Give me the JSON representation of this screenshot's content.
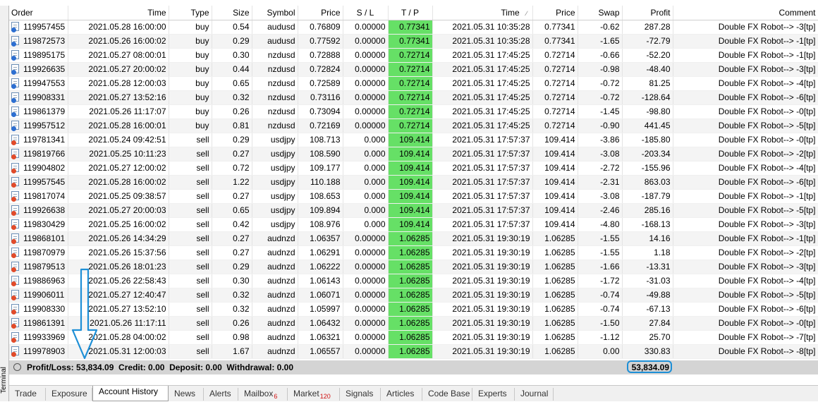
{
  "terminal": {
    "side_label": "Terminal",
    "columns": [
      "Order",
      "Time",
      "Type",
      "Size",
      "Symbol",
      "Price",
      "S / L",
      "T / P",
      "Time",
      "Price",
      "Swap",
      "Profit",
      "Comment"
    ],
    "sort_indicator": "∕",
    "rows": [
      {
        "order": "119957455",
        "open_time": "2021.05.28 16:00:00",
        "type": "buy",
        "size": "0.54",
        "symbol": "audusd",
        "open_price": "0.76809",
        "sl": "0.00000",
        "tp": "0.77341",
        "close_time": "2021.05.31 10:35:28",
        "close_price": "0.77341",
        "swap": "-0.62",
        "profit": "287.28",
        "comment": "Double FX Robot--> -3[tp]"
      },
      {
        "order": "119872573",
        "open_time": "2021.05.26 16:00:02",
        "type": "buy",
        "size": "0.29",
        "symbol": "audusd",
        "open_price": "0.77592",
        "sl": "0.00000",
        "tp": "0.77341",
        "close_time": "2021.05.31 10:35:28",
        "close_price": "0.77341",
        "swap": "-1.65",
        "profit": "-72.79",
        "comment": "Double FX Robot--> -1[tp]"
      },
      {
        "order": "119895175",
        "open_time": "2021.05.27 08:00:01",
        "type": "buy",
        "size": "0.30",
        "symbol": "nzdusd",
        "open_price": "0.72888",
        "sl": "0.00000",
        "tp": "0.72714",
        "close_time": "2021.05.31 17:45:25",
        "close_price": "0.72714",
        "swap": "-0.66",
        "profit": "-52.20",
        "comment": "Double FX Robot--> -1[tp]"
      },
      {
        "order": "119926635",
        "open_time": "2021.05.27 20:00:02",
        "type": "buy",
        "size": "0.44",
        "symbol": "nzdusd",
        "open_price": "0.72824",
        "sl": "0.00000",
        "tp": "0.72714",
        "close_time": "2021.05.31 17:45:25",
        "close_price": "0.72714",
        "swap": "-0.98",
        "profit": "-48.40",
        "comment": "Double FX Robot--> -3[tp]"
      },
      {
        "order": "119947553",
        "open_time": "2021.05.28 12:00:03",
        "type": "buy",
        "size": "0.65",
        "symbol": "nzdusd",
        "open_price": "0.72589",
        "sl": "0.00000",
        "tp": "0.72714",
        "close_time": "2021.05.31 17:45:25",
        "close_price": "0.72714",
        "swap": "-0.72",
        "profit": "81.25",
        "comment": "Double FX Robot--> -4[tp]"
      },
      {
        "order": "119908331",
        "open_time": "2021.05.27 13:52:16",
        "type": "buy",
        "size": "0.32",
        "symbol": "nzdusd",
        "open_price": "0.73116",
        "sl": "0.00000",
        "tp": "0.72714",
        "close_time": "2021.05.31 17:45:25",
        "close_price": "0.72714",
        "swap": "-0.72",
        "profit": "-128.64",
        "comment": "Double FX Robot--> -6[tp]"
      },
      {
        "order": "119861379",
        "open_time": "2021.05.26 11:17:07",
        "type": "buy",
        "size": "0.26",
        "symbol": "nzdusd",
        "open_price": "0.73094",
        "sl": "0.00000",
        "tp": "0.72714",
        "close_time": "2021.05.31 17:45:25",
        "close_price": "0.72714",
        "swap": "-1.45",
        "profit": "-98.80",
        "comment": "Double FX Robot--> -0[tp]"
      },
      {
        "order": "119957512",
        "open_time": "2021.05.28 16:00:01",
        "type": "buy",
        "size": "0.81",
        "symbol": "nzdusd",
        "open_price": "0.72169",
        "sl": "0.00000",
        "tp": "0.72714",
        "close_time": "2021.05.31 17:45:25",
        "close_price": "0.72714",
        "swap": "-0.90",
        "profit": "441.45",
        "comment": "Double FX Robot--> -5[tp]"
      },
      {
        "order": "119781341",
        "open_time": "2021.05.24 09:42:51",
        "type": "sell",
        "size": "0.29",
        "symbol": "usdjpy",
        "open_price": "108.713",
        "sl": "0.000",
        "tp": "109.414",
        "close_time": "2021.05.31 17:57:37",
        "close_price": "109.414",
        "swap": "-3.86",
        "profit": "-185.80",
        "comment": "Double FX Robot--> -0[tp]"
      },
      {
        "order": "119819766",
        "open_time": "2021.05.25 10:11:23",
        "type": "sell",
        "size": "0.27",
        "symbol": "usdjpy",
        "open_price": "108.590",
        "sl": "0.000",
        "tp": "109.414",
        "close_time": "2021.05.31 17:57:37",
        "close_price": "109.414",
        "swap": "-3.08",
        "profit": "-203.34",
        "comment": "Double FX Robot--> -2[tp]"
      },
      {
        "order": "119904802",
        "open_time": "2021.05.27 12:00:02",
        "type": "sell",
        "size": "0.72",
        "symbol": "usdjpy",
        "open_price": "109.177",
        "sl": "0.000",
        "tp": "109.414",
        "close_time": "2021.05.31 17:57:37",
        "close_price": "109.414",
        "swap": "-2.72",
        "profit": "-155.96",
        "comment": "Double FX Robot--> -4[tp]"
      },
      {
        "order": "119957545",
        "open_time": "2021.05.28 16:00:02",
        "type": "sell",
        "size": "1.22",
        "symbol": "usdjpy",
        "open_price": "110.188",
        "sl": "0.000",
        "tp": "109.414",
        "close_time": "2021.05.31 17:57:37",
        "close_price": "109.414",
        "swap": "-2.31",
        "profit": "863.03",
        "comment": "Double FX Robot--> -6[tp]"
      },
      {
        "order": "119817074",
        "open_time": "2021.05.25 09:38:57",
        "type": "sell",
        "size": "0.27",
        "symbol": "usdjpy",
        "open_price": "108.653",
        "sl": "0.000",
        "tp": "109.414",
        "close_time": "2021.05.31 17:57:37",
        "close_price": "109.414",
        "swap": "-3.08",
        "profit": "-187.79",
        "comment": "Double FX Robot--> -1[tp]"
      },
      {
        "order": "119926638",
        "open_time": "2021.05.27 20:00:03",
        "type": "sell",
        "size": "0.65",
        "symbol": "usdjpy",
        "open_price": "109.894",
        "sl": "0.000",
        "tp": "109.414",
        "close_time": "2021.05.31 17:57:37",
        "close_price": "109.414",
        "swap": "-2.46",
        "profit": "285.16",
        "comment": "Double FX Robot--> -5[tp]"
      },
      {
        "order": "119830429",
        "open_time": "2021.05.25 16:00:02",
        "type": "sell",
        "size": "0.42",
        "symbol": "usdjpy",
        "open_price": "108.976",
        "sl": "0.000",
        "tp": "109.414",
        "close_time": "2021.05.31 17:57:37",
        "close_price": "109.414",
        "swap": "-4.80",
        "profit": "-168.13",
        "comment": "Double FX Robot--> -3[tp]"
      },
      {
        "order": "119868101",
        "open_time": "2021.05.26 14:34:29",
        "type": "sell",
        "size": "0.27",
        "symbol": "audnzd",
        "open_price": "1.06357",
        "sl": "0.00000",
        "tp": "1.06285",
        "close_time": "2021.05.31 19:30:19",
        "close_price": "1.06285",
        "swap": "-1.55",
        "profit": "14.16",
        "comment": "Double FX Robot--> -1[tp]"
      },
      {
        "order": "119870979",
        "open_time": "2021.05.26 15:37:56",
        "type": "sell",
        "size": "0.27",
        "symbol": "audnzd",
        "open_price": "1.06291",
        "sl": "0.00000",
        "tp": "1.06285",
        "close_time": "2021.05.31 19:30:19",
        "close_price": "1.06285",
        "swap": "-1.55",
        "profit": "1.18",
        "comment": "Double FX Robot--> -2[tp]"
      },
      {
        "order": "119879513",
        "open_time": "2021.05.26 18:01:23",
        "type": "sell",
        "size": "0.29",
        "symbol": "audnzd",
        "open_price": "1.06222",
        "sl": "0.00000",
        "tp": "1.06285",
        "close_time": "2021.05.31 19:30:19",
        "close_price": "1.06285",
        "swap": "-1.66",
        "profit": "-13.31",
        "comment": "Double FX Robot--> -3[tp]"
      },
      {
        "order": "119886963",
        "open_time": "2021.05.26 22:58:43",
        "type": "sell",
        "size": "0.30",
        "symbol": "audnzd",
        "open_price": "1.06143",
        "sl": "0.00000",
        "tp": "1.06285",
        "close_time": "2021.05.31 19:30:19",
        "close_price": "1.06285",
        "swap": "-1.72",
        "profit": "-31.03",
        "comment": "Double FX Robot--> -4[tp]"
      },
      {
        "order": "119906011",
        "open_time": "2021.05.27 12:40:47",
        "type": "sell",
        "size": "0.32",
        "symbol": "audnzd",
        "open_price": "1.06071",
        "sl": "0.00000",
        "tp": "1.06285",
        "close_time": "2021.05.31 19:30:19",
        "close_price": "1.06285",
        "swap": "-0.74",
        "profit": "-49.88",
        "comment": "Double FX Robot--> -5[tp]"
      },
      {
        "order": "119908330",
        "open_time": "2021.05.27 13:52:10",
        "type": "sell",
        "size": "0.32",
        "symbol": "audnzd",
        "open_price": "1.05997",
        "sl": "0.00000",
        "tp": "1.06285",
        "close_time": "2021.05.31 19:30:19",
        "close_price": "1.06285",
        "swap": "-0.74",
        "profit": "-67.13",
        "comment": "Double FX Robot--> -6[tp]"
      },
      {
        "order": "119861391",
        "open_time": "2021.05.26 11:17:11",
        "type": "sell",
        "size": "0.26",
        "symbol": "audnzd",
        "open_price": "1.06432",
        "sl": "0.00000",
        "tp": "1.06285",
        "close_time": "2021.05.31 19:30:19",
        "close_price": "1.06285",
        "swap": "-1.50",
        "profit": "27.84",
        "comment": "Double FX Robot--> -0[tp]"
      },
      {
        "order": "119933969",
        "open_time": "2021.05.28 04:00:02",
        "type": "sell",
        "size": "0.98",
        "symbol": "audnzd",
        "open_price": "1.06321",
        "sl": "0.00000",
        "tp": "1.06285",
        "close_time": "2021.05.31 19:30:19",
        "close_price": "1.06285",
        "swap": "-1.12",
        "profit": "25.70",
        "comment": "Double FX Robot--> -7[tp]"
      },
      {
        "order": "119978903",
        "open_time": "2021.05.31 12:00:03",
        "type": "sell",
        "size": "1.67",
        "symbol": "audnzd",
        "open_price": "1.06557",
        "sl": "0.00000",
        "tp": "1.06285",
        "close_time": "2021.05.31 19:30:19",
        "close_price": "1.06285",
        "swap": "0.00",
        "profit": "330.83",
        "comment": "Double FX Robot--> -8[tp]"
      }
    ],
    "summary": {
      "text": "Profit/Loss: 53,834.09  Credit: 0.00  Deposit: 0.00  Withdrawal: 0.00",
      "profit_total": "53,834.09"
    },
    "tabs": [
      {
        "label": "Trade",
        "badge": ""
      },
      {
        "label": "Exposure",
        "badge": ""
      },
      {
        "label": "Account History",
        "badge": ""
      },
      {
        "label": "News",
        "badge": ""
      },
      {
        "label": "Alerts",
        "badge": ""
      },
      {
        "label": "Mailbox",
        "badge": "6"
      },
      {
        "label": "Market",
        "badge": "120"
      },
      {
        "label": "Signals",
        "badge": ""
      },
      {
        "label": "Articles",
        "badge": ""
      },
      {
        "label": "Code Base",
        "badge": ""
      },
      {
        "label": "Experts",
        "badge": ""
      },
      {
        "label": "Journal",
        "badge": ""
      }
    ],
    "active_tab": "Account History",
    "colors": {
      "tp_highlight": "#66e066",
      "annotation": "#1e8fd6",
      "buy_icon": "#2d6fd1",
      "sell_icon": "#e14b2a"
    }
  }
}
